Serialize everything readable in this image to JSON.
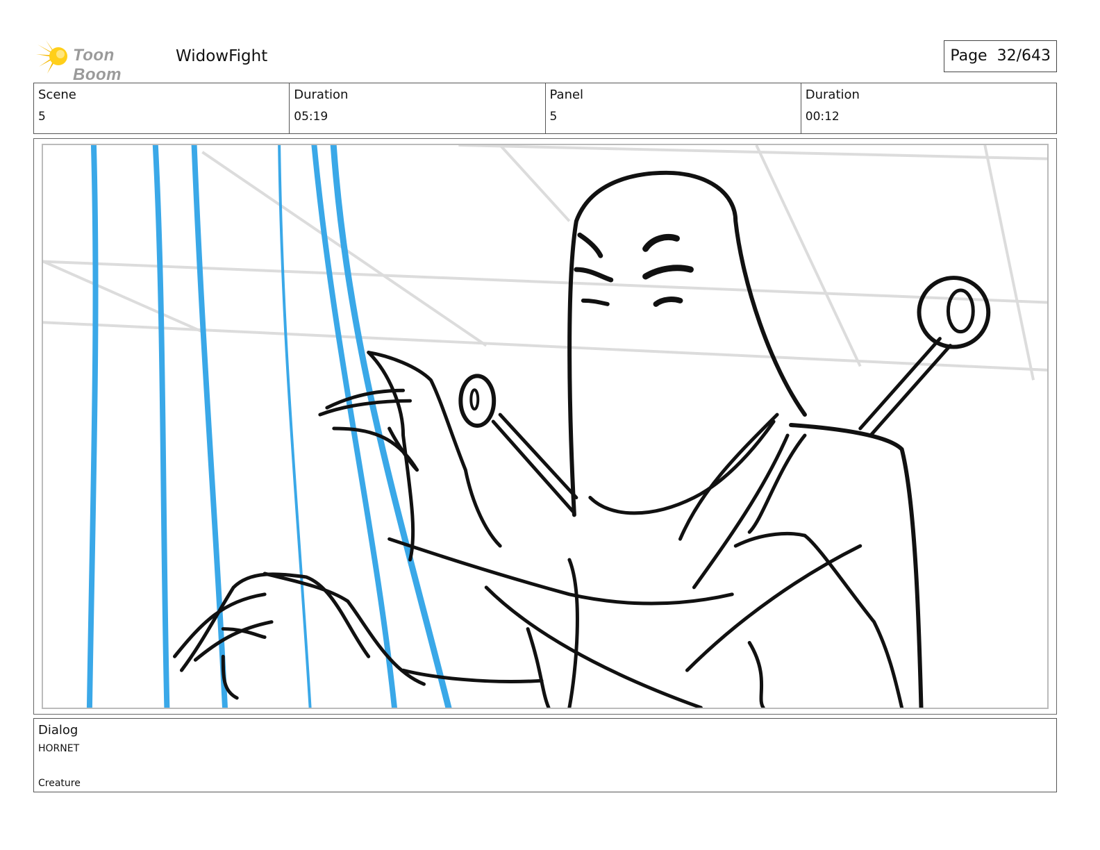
{
  "header": {
    "brand": "Toon Boom",
    "project_title": "WidowFight",
    "page_label": "Page",
    "page_value": "32/643"
  },
  "info": {
    "scene_label": "Scene",
    "scene_value": "5",
    "scene_duration_label": "Duration",
    "scene_duration_value": "05:19",
    "panel_label": "Panel",
    "panel_value": "5",
    "panel_duration_label": "Duration",
    "panel_duration_value": "00:12"
  },
  "dialog": {
    "label": "Dialog",
    "speaker": "HORNET",
    "note": "Creature"
  },
  "colors": {
    "logo_star": "#f5b800",
    "thread_blue": "#3aa8e8",
    "sketch_ink": "#111111",
    "guide_gray": "#dcdcdc"
  }
}
